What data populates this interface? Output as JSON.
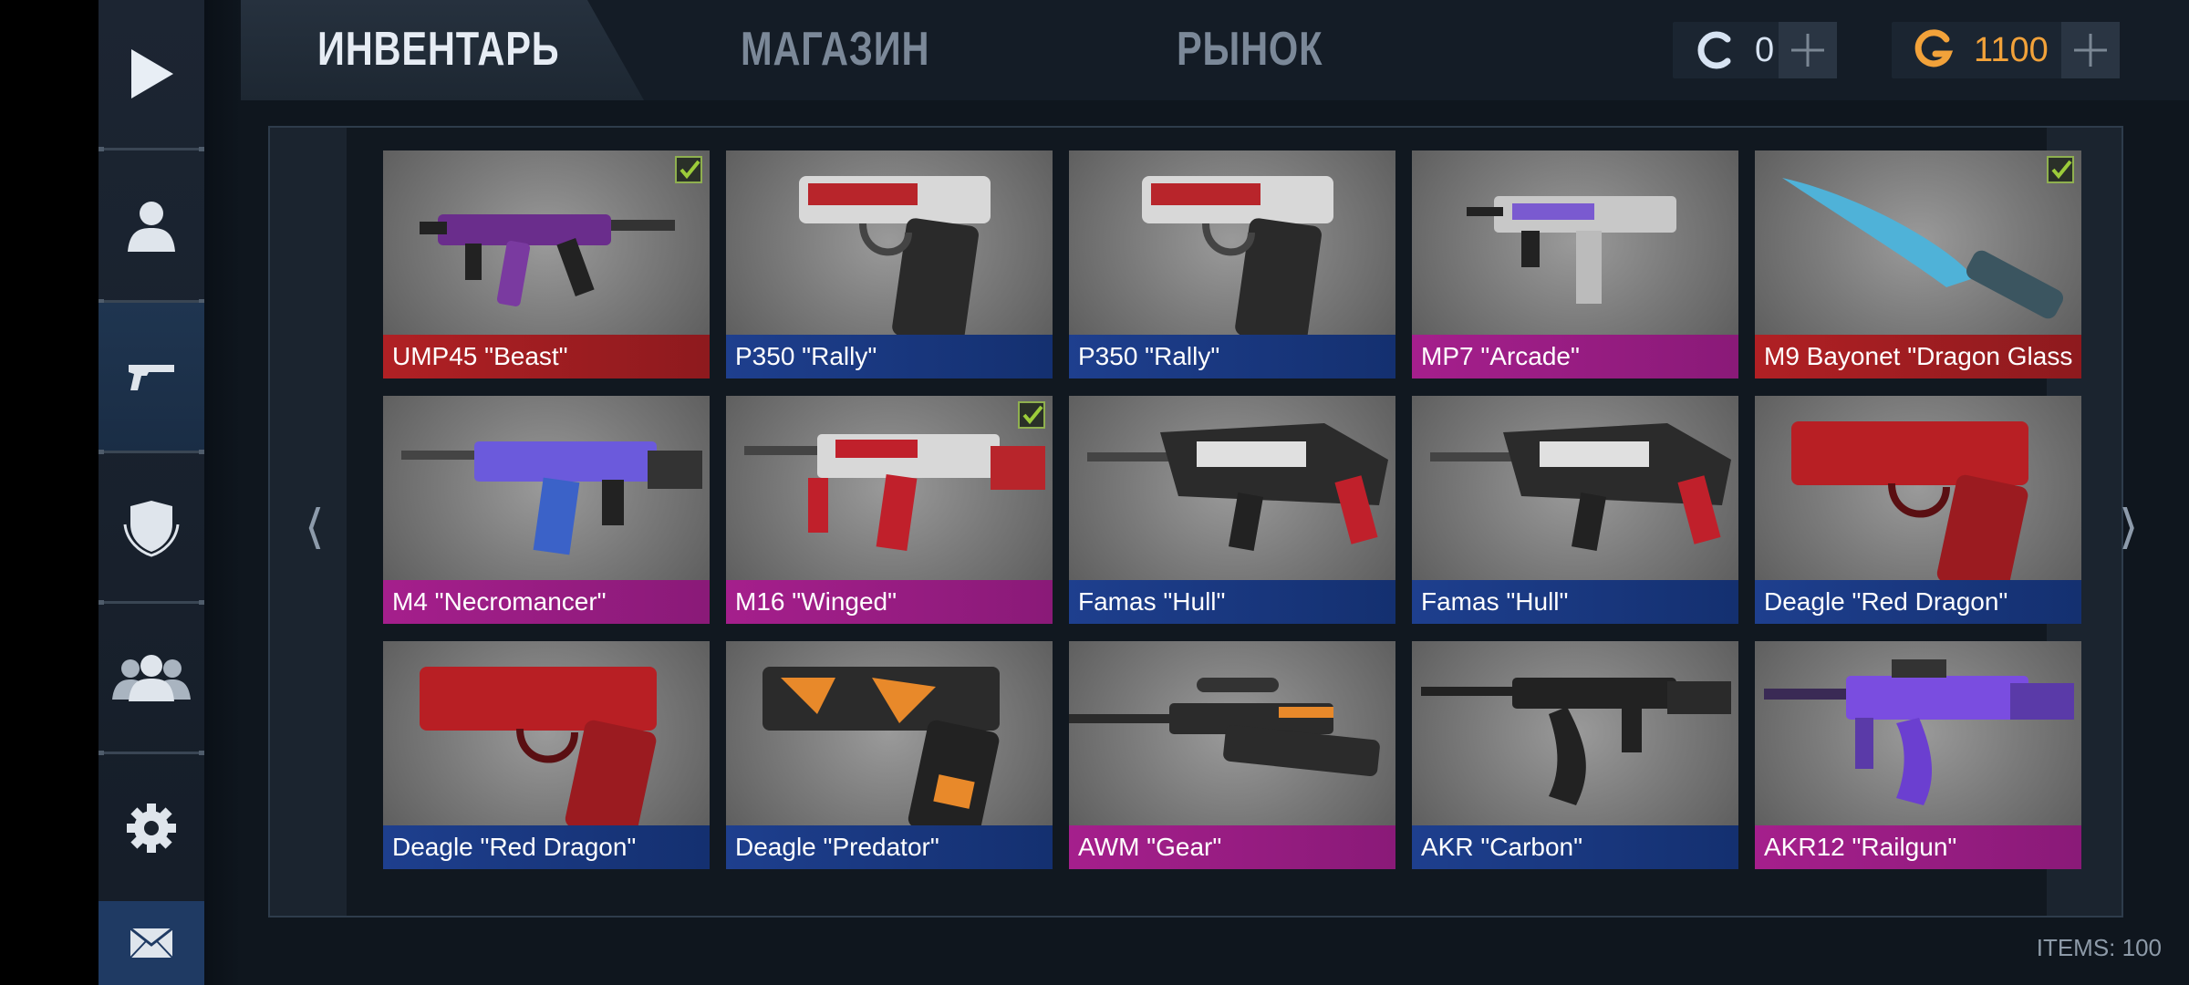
{
  "tabs": [
    {
      "label": "ИНВЕНТАРЬ",
      "active": true
    },
    {
      "label": "МАГАЗИН",
      "active": false
    },
    {
      "label": "РЫНОК",
      "active": false
    }
  ],
  "currency": {
    "coins": {
      "value": "0",
      "icon": "coin-c-icon"
    },
    "gold": {
      "value": "1100",
      "icon": "gold-g-icon"
    }
  },
  "sidebar": {
    "items": [
      {
        "icon": "play-icon"
      },
      {
        "icon": "profile-icon"
      },
      {
        "icon": "pistol-icon",
        "active": true
      },
      {
        "icon": "clan-shield-icon"
      },
      {
        "icon": "friends-icon"
      },
      {
        "icon": "gear-icon"
      },
      {
        "icon": "mail-icon"
      }
    ]
  },
  "colors": {
    "red": "#b02024",
    "blue": "#1e3f8e",
    "pink": "#a51f8c",
    "check": "#8fb04f"
  },
  "inventory": {
    "items": [
      {
        "name": "UMP45 \"Beast\"",
        "rarity": "red",
        "equipped": true
      },
      {
        "name": "P350 \"Rally\"",
        "rarity": "blue",
        "equipped": false
      },
      {
        "name": "P350 \"Rally\"",
        "rarity": "blue",
        "equipped": false
      },
      {
        "name": "MP7 \"Arcade\"",
        "rarity": "pink",
        "equipped": false
      },
      {
        "name": "M9 Bayonet \"Dragon Glass",
        "rarity": "red",
        "equipped": true
      },
      {
        "name": "M4 \"Necromancer\"",
        "rarity": "pink",
        "equipped": false
      },
      {
        "name": "M16 \"Winged\"",
        "rarity": "pink",
        "equipped": true
      },
      {
        "name": "Famas \"Hull\"",
        "rarity": "blue",
        "equipped": false
      },
      {
        "name": "Famas \"Hull\"",
        "rarity": "blue",
        "equipped": false
      },
      {
        "name": "Deagle \"Red Dragon\"",
        "rarity": "blue",
        "equipped": false
      },
      {
        "name": "Deagle \"Red Dragon\"",
        "rarity": "blue",
        "equipped": false
      },
      {
        "name": "Deagle \"Predator\"",
        "rarity": "blue",
        "equipped": false
      },
      {
        "name": "AWM \"Gear\"",
        "rarity": "pink",
        "equipped": false
      },
      {
        "name": "AKR \"Carbon\"",
        "rarity": "blue",
        "equipped": false
      },
      {
        "name": "AKR12 \"Railgun\"",
        "rarity": "pink",
        "equipped": false
      }
    ],
    "prev_label": "❬",
    "next_label": "❭"
  },
  "footer": {
    "items_count": "ITEMS: 100"
  }
}
